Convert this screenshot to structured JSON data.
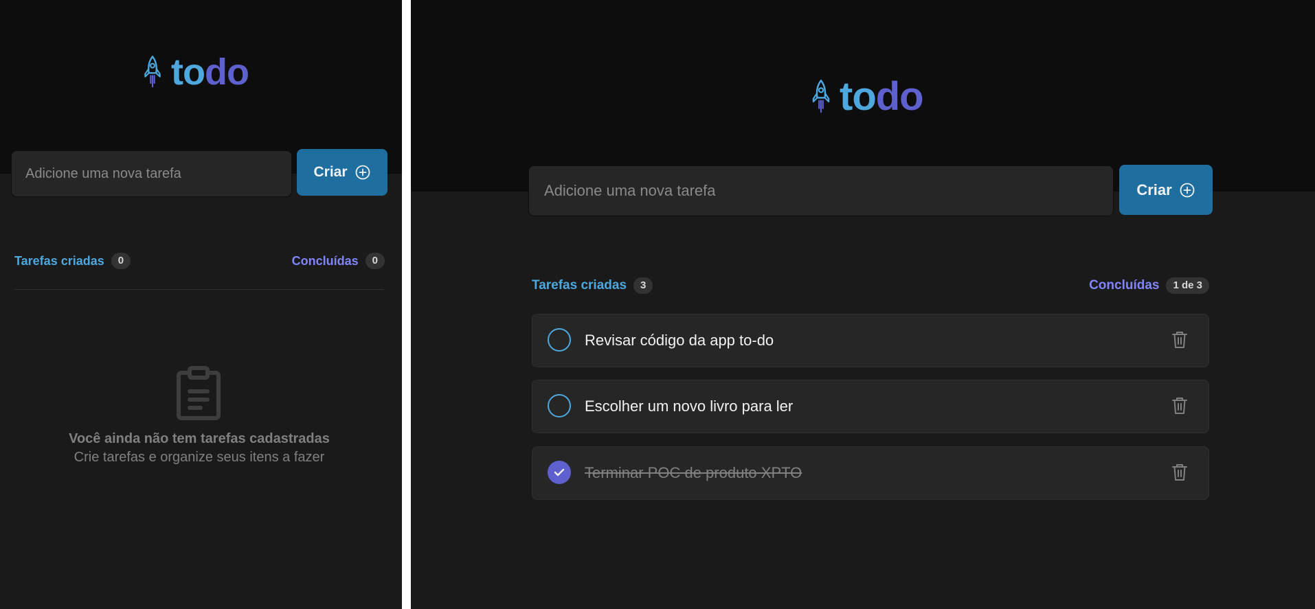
{
  "app": {
    "logo_to": "to",
    "logo_do": "do"
  },
  "colors": {
    "blue": "#4ea8de",
    "purple": "#5e60ce",
    "purple_light": "#8284fa",
    "button": "#1e6f9f"
  },
  "mobile": {
    "input_placeholder": "Adicione uma nova tarefa",
    "create_label": "Criar",
    "created_label": "Tarefas criadas",
    "created_count": "0",
    "done_label": "Concluídas",
    "done_count": "0",
    "empty_title": "Você ainda não tem tarefas cadastradas",
    "empty_subtitle": "Crie tarefas e organize seus itens a fazer",
    "empty_icon": "clipboard-icon"
  },
  "desktop": {
    "input_placeholder": "Adicione uma nova tarefa",
    "create_label": "Criar",
    "created_label": "Tarefas criadas",
    "created_count": "3",
    "done_label": "Concluídas",
    "done_count": "1 de 3",
    "tasks": [
      {
        "text": "Revisar código da app to-do",
        "done": false
      },
      {
        "text": "Escolher um novo livro para ler",
        "done": false
      },
      {
        "text": "Terminar POC de produto XPTO",
        "done": true
      }
    ]
  }
}
